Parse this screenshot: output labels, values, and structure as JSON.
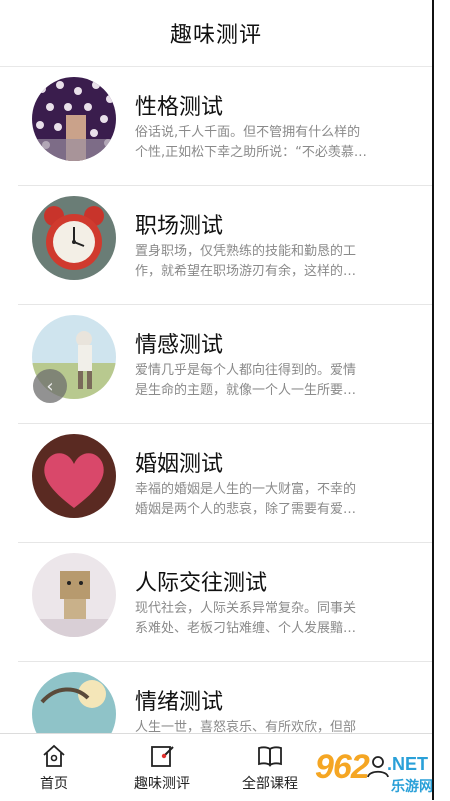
{
  "header": {
    "title": "趣味测评"
  },
  "items": [
    {
      "title": "性格测试",
      "desc1": "俗话说,千人千面。但不管拥有什么样的",
      "desc2": "个性,正如松下幸之助所说：“不必羡慕…"
    },
    {
      "title": "职场测试",
      "desc1": "置身职场，仅凭熟练的技能和勤恳的工",
      "desc2": "作，就希望在职场游刃有余，这样的…"
    },
    {
      "title": "情感测试",
      "desc1": "爱情几乎是每个人都向往得到的。爱情",
      "desc2": "是生命的主题，就像一个人一生所要…"
    },
    {
      "title": "婚姻测试",
      "desc1": "幸福的婚姻是人生的一大财富，不幸的",
      "desc2": "婚姻是两个人的悲哀，除了需要有爱…"
    },
    {
      "title": "人际交往测试",
      "desc1": "现代社会，人际关系异常复杂。同事关",
      "desc2": "系难处、老板刁钻难缠、个人发展黯…"
    },
    {
      "title": "情绪测试",
      "desc1": "人生一世，喜怒哀乐、有所欢欣，但部",
      "desc2": ""
    }
  ],
  "back_button": {
    "glyph": "‹"
  },
  "tabs": [
    {
      "label": "首页",
      "icon": "home-icon"
    },
    {
      "label": "趣味测评",
      "icon": "edit-checklist-icon"
    },
    {
      "label": "全部课程",
      "icon": "book-icon"
    },
    {
      "label": "",
      "icon": "profile-icon"
    }
  ],
  "watermark": {
    "logo": "962",
    "net": ".NET",
    "cn": "乐游网"
  },
  "colors": {
    "accent_red": "#e0312e",
    "watermark_orange": "#f5a623",
    "watermark_blue": "#2aa0d8"
  }
}
